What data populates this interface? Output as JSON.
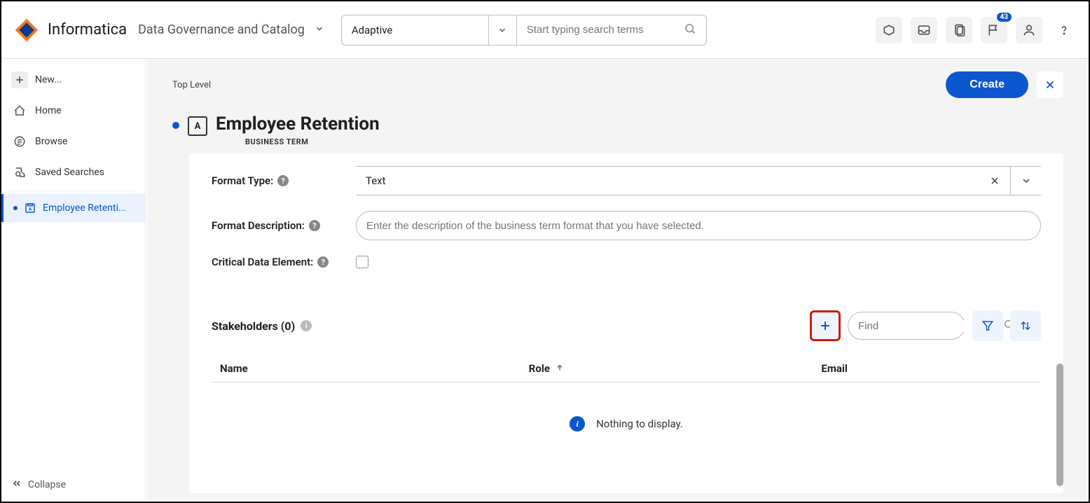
{
  "header": {
    "brand": "Informatica",
    "suite": "Data Governance and Catalog",
    "search_type": "Adaptive",
    "search_placeholder": "Start typing search terms",
    "notif_badge": "43"
  },
  "sidebar": {
    "new_label": "New...",
    "items": [
      {
        "label": "Home",
        "icon": "home"
      },
      {
        "label": "Browse",
        "icon": "browse"
      },
      {
        "label": "Saved Searches",
        "icon": "saved"
      }
    ],
    "open_tab": "Employee Retenti...",
    "collapse": "Collapse"
  },
  "breadcrumb": "Top Level",
  "actions": {
    "create": "Create"
  },
  "page": {
    "title": "Employee Retention",
    "subtitle": "BUSINESS TERM"
  },
  "form": {
    "format_type_label": "Format Type:",
    "format_type_value": "Text",
    "format_desc_label": "Format Description:",
    "format_desc_placeholder": "Enter the description of the business term format that you have selected.",
    "cde_label": "Critical Data Element:"
  },
  "stakeholders": {
    "title": "Stakeholders (0)",
    "find_placeholder": "Find",
    "cols": {
      "name": "Name",
      "role": "Role",
      "email": "Email"
    },
    "empty": "Nothing to display."
  }
}
